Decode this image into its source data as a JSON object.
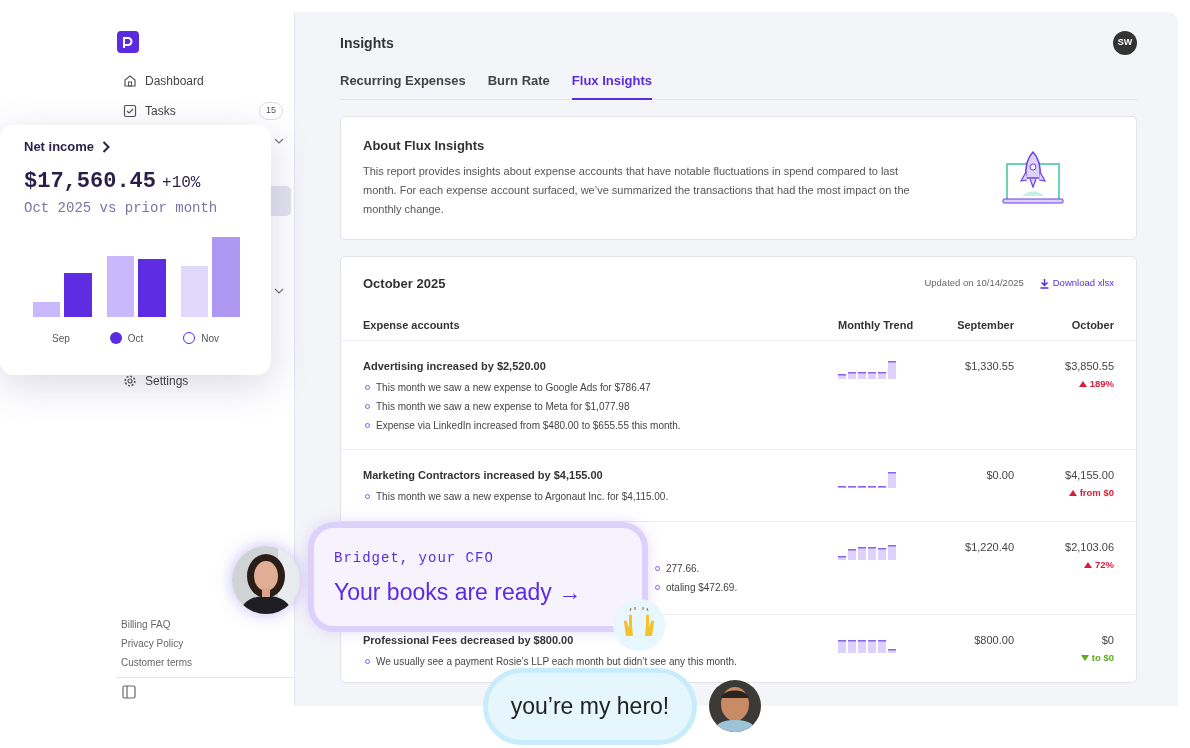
{
  "sidebar": {
    "items": [
      {
        "kind": "home",
        "label": "Dashboard",
        "selected": false
      },
      {
        "kind": "tasks",
        "label": "Tasks",
        "badge": "15",
        "selected": false
      },
      {
        "kind": "covered",
        "collapsible": true,
        "selected": false
      },
      {
        "kind": "covered",
        "collapsible": false,
        "selected": false
      },
      {
        "kind": "covered",
        "collapsible": false,
        "selected": true
      },
      {
        "kind": "covered",
        "collapsible": false,
        "selected": false
      },
      {
        "kind": "covered",
        "collapsible": false,
        "selected": false
      },
      {
        "kind": "covered",
        "collapsible": true,
        "selected": false
      },
      {
        "kind": "covered",
        "collapsible": false,
        "selected": false
      },
      {
        "kind": "covered",
        "collapsible": false,
        "selected": false
      },
      {
        "kind": "settings",
        "label": "Settings",
        "selected": false
      }
    ],
    "footer_links": [
      "Billing FAQ",
      "Privacy Policy",
      "Customer terms"
    ]
  },
  "header": {
    "title": "Insights",
    "avatar": "SW"
  },
  "tabs": [
    {
      "label": "Recurring Expenses",
      "selected": false
    },
    {
      "label": "Burn Rate",
      "selected": false
    },
    {
      "label": "Flux Insights",
      "selected": true
    }
  ],
  "about": {
    "title": "About Flux Insights",
    "text": "This report provides insights about expense accounts that have notable fluctuations in spend compared to last month. For each expense account surfaced, we’ve summarized the transactions that had the most impact on the monthly change."
  },
  "report": {
    "title": "October 2025",
    "updated": "Updated on 10/14/2025",
    "download": "Download xlsx",
    "columns": [
      "Expense accounts",
      "Monthly Trend",
      "September",
      "October"
    ],
    "rows": [
      {
        "title": "Advertising increased by $2,520.00",
        "bullets": [
          "This month we saw a new expense to Google Ads for $786.47",
          "This month we saw a new expense to Meta for $1,077.98",
          "Expense via LinkedIn increased from $480.00 to $655.55 this month."
        ],
        "september": "$1,330.55",
        "october": "$3,850.55",
        "change": {
          "text": "189%",
          "kind": "increase"
        }
      },
      {
        "title": "Marketing Contractors increased by $4,155.00",
        "bullets": [
          "This month we saw a new expense to Argonaut Inc. for $4,115.00."
        ],
        "september": "$0.00",
        "october": "$4,155.00",
        "change": {
          "text": "from $0",
          "kind": "increase"
        }
      },
      {
        "kind": "covered",
        "bullets": [
          "277.66.",
          "otaling $472.69."
        ],
        "september": "$1,220.40",
        "october": "$2,103.06",
        "change": {
          "text": "72%",
          "kind": "increase"
        }
      },
      {
        "title": "Professional Fees decreased by $800.00",
        "bullets": [
          "We usually see a payment Rosie’s LLP each month but didn’t see any this month."
        ],
        "september": "$800.00",
        "october": "$0",
        "change": {
          "text": "to $0",
          "kind": "decrease"
        }
      }
    ]
  },
  "net_income_card": {
    "title": "Net income",
    "amount": "$17,560.45",
    "change": "+10%",
    "subtitle": "Oct 2025 vs prior month",
    "legend": [
      {
        "label": "Sep",
        "kind": "none"
      },
      {
        "label": "Oct",
        "kind": "filled"
      },
      {
        "label": "Nov",
        "kind": "outline"
      }
    ]
  },
  "cfo_bubble": {
    "caption": "Bridget, your CFO",
    "message": "Your books are ready →"
  },
  "reply_bubble": {
    "message": "you’re my hero!"
  }
}
